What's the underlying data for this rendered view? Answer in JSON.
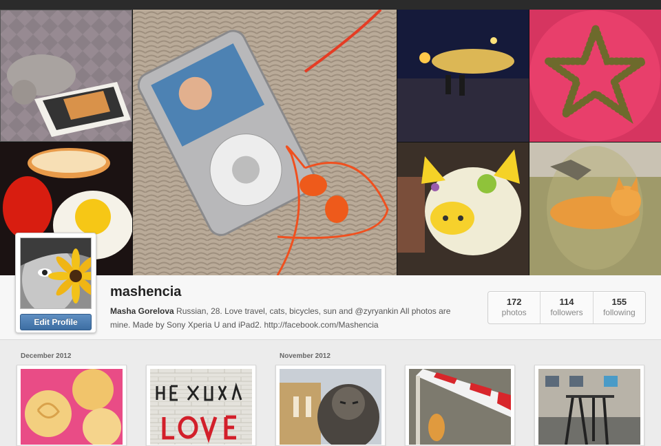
{
  "profile": {
    "username": "mashencia",
    "full_name": "Masha Gorelova",
    "bio": "Russian, 28. Love travel, cats, bicycles, sun and @zyryankin All photos are mine. Made by Sony Xperia U and iPad2. http://facebook.com/Mashencia",
    "edit_button": "Edit Profile"
  },
  "stats": [
    {
      "count": "172",
      "label": "photos"
    },
    {
      "count": "114",
      "label": "followers"
    },
    {
      "count": "155",
      "label": "following"
    }
  ],
  "groups": [
    {
      "month": "December 2012"
    },
    {
      "month": "November 2012"
    }
  ],
  "collage": [
    {
      "subject": "cat-with-tablet"
    },
    {
      "subject": "ipod-with-earphones-heart"
    },
    {
      "subject": "night-street-lights"
    },
    {
      "subject": "star-of-olives"
    },
    {
      "subject": "breakfast-egg-bread"
    },
    {
      "subject": "piggy-bank"
    },
    {
      "subject": "ginger-cat-on-grass"
    }
  ],
  "thumbnails": [
    {
      "subject": "baked-rolls"
    },
    {
      "subject": "graffiti-wall"
    },
    {
      "subject": "lion-statue"
    },
    {
      "subject": "cat-barrier"
    },
    {
      "subject": "playground-swings"
    }
  ]
}
